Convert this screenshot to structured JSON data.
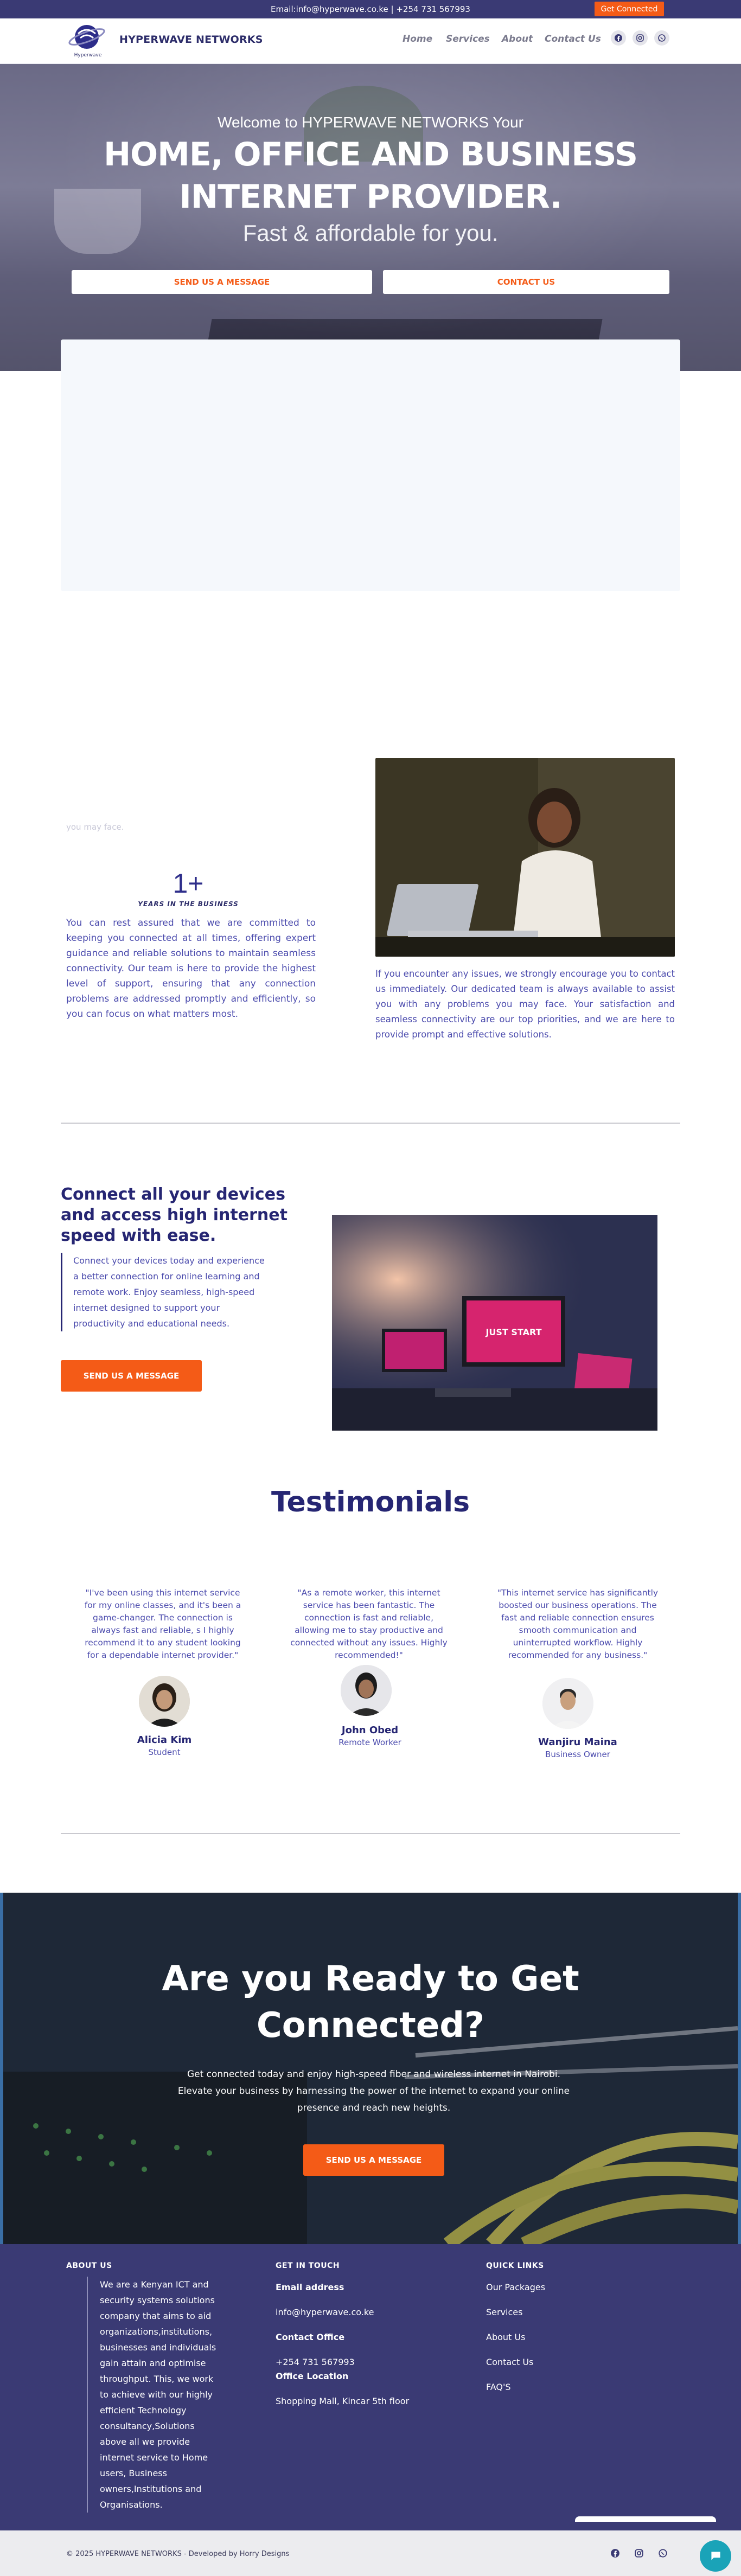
{
  "topbar": {
    "contact": "Email:info@hyperwave.co.ke | +254 731 567993",
    "cta": "Get Connected"
  },
  "header": {
    "logo_text": "Hyperwave",
    "brand": "HYPERWAVE NETWORKS",
    "nav": [
      "Home",
      "Services",
      "About",
      "Contact Us"
    ]
  },
  "hero": {
    "welcome": "Welcome to HYPERWAVE NETWORKS Your",
    "headline_1": "HOME, OFFICE AND BUSINESS",
    "headline_2": "INTERNET PROVIDER.",
    "tagline": "Fast & affordable for you.",
    "btn_message": "SEND US A MESSAGE",
    "btn_contact": "CONTACT US"
  },
  "about": {
    "faded_text": "you may face.",
    "years_num": "1+",
    "years_label": "YEARS IN THE BUSINESS",
    "left_para": "You can rest assured that we are committed to keeping you connected at all times, offering expert guidance and reliable solutions to maintain seamless connectivity. Our team is here to provide the highest level of support, ensuring that any connection problems are addressed promptly and efficiently, so you can focus on what matters most.",
    "right_para": "If you encounter any issues, we strongly encourage you to contact us immediately. Our dedicated team is always available to assist you with any problems you may face. Your satisfaction and seamless connectivity are our top priorities, and we are here to provide prompt and effective solutions."
  },
  "connect": {
    "title": "Connect all your devices and access high internet speed with ease.",
    "text": "Connect your devices today and experience a better connection for online learning and remote work. Enjoy seamless, high-speed internet designed to support your productivity and educational needs.",
    "btn": "SEND US A MESSAGE",
    "screen_text": "JUST START"
  },
  "testimonials": {
    "title": "Testimonials",
    "items": [
      {
        "quote": "\"I've been using this internet service for my online classes, and it's been a game-changer. The connection is always fast and reliable, s I highly recommend it to any student looking for a dependable internet provider.\"",
        "name": "Alicia Kim",
        "role": "Student"
      },
      {
        "quote": "\"As a remote worker, this internet service has been fantastic. The connection is fast and reliable, allowing me to stay productive and connected without any issues. Highly recommended!\"",
        "name": "John Obed",
        "role": "Remote Worker"
      },
      {
        "quote": "\"This internet service has significantly boosted our business operations. The fast and reliable connection ensures smooth communication and uninterrupted workflow. Highly recommended for any business.\"",
        "name": "Wanjiru Maina",
        "role": "Business Owner"
      }
    ]
  },
  "cta": {
    "title_1": "Are you Ready to Get",
    "title_2": "Connected?",
    "text": "Get connected today and enjoy high-speed fiber and wireless internet in Nairobi. Elevate your business by harnessing the power of the internet to expand your online presence and reach new heights.",
    "btn": "SEND US A MESSAGE"
  },
  "footer": {
    "about_heading": "ABOUT US",
    "about_text": "We are a Kenyan ICT and security systems solutions company that aims to aid organizations,institutions, businesses and individuals gain attain and optimise throughput. This, we work to achieve with our highly efficient Technology consultancy,Solutions above all we provide internet service to Home users, Business owners,Institutions and Organisations.",
    "touch_heading": "GET IN TOUCH",
    "email_label": "Email address",
    "email": "info@hyperwave.co.ke",
    "office_label": "Contact Office",
    "phone": "+254 731 567993",
    "location_label": "Office Location",
    "location": "Shopping Mall, Kincar 5th floor",
    "links_heading": "QUICK LINKS",
    "links": [
      "Our Packages",
      "Services",
      "About Us",
      "Contact Us",
      "FAQ'S"
    ],
    "copyright": "© 2025 HYPERWAVE NETWORKS - Developed by Horry Designs"
  },
  "icons": {
    "facebook": "facebook-icon",
    "instagram": "instagram-icon",
    "whatsapp": "whatsapp-icon",
    "chat": "chat-icon"
  },
  "colors": {
    "accent": "#f45b17",
    "navy": "#262673",
    "footer_bg": "#3a3a74"
  }
}
